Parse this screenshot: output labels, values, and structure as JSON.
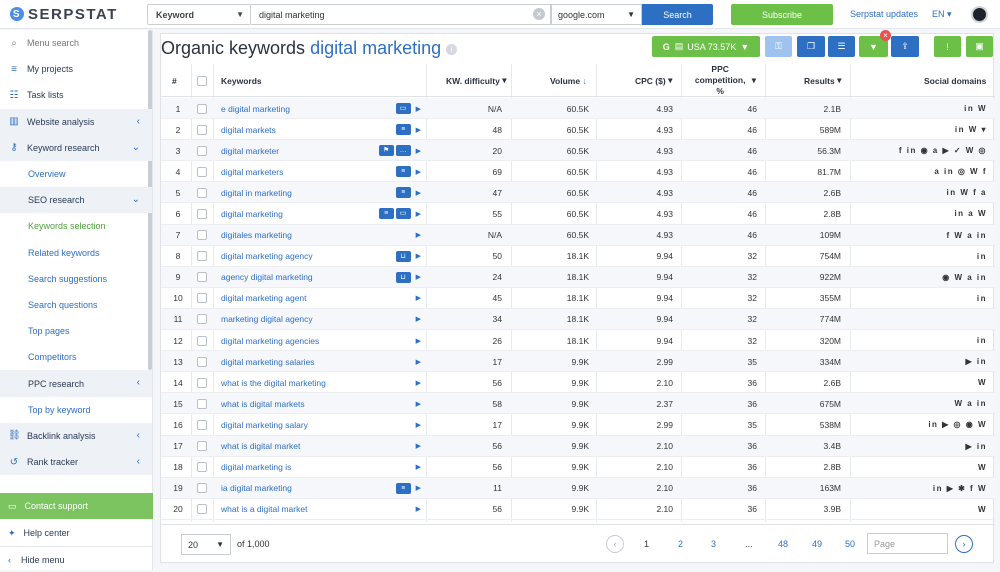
{
  "topbar": {
    "logo_text": "SERPSTAT",
    "search_type": "Keyword",
    "query": "digital marketing",
    "database": "google.com",
    "search_label": "Search",
    "subscribe_label": "Subscribe",
    "updates_label": "Serpstat updates",
    "language": "EN"
  },
  "sidebar": {
    "menu_search_placeholder": "Menu search",
    "items": [
      {
        "label": "My projects",
        "icon": "layers-icon",
        "type": "top"
      },
      {
        "label": "Task lists",
        "icon": "list-icon",
        "type": "top"
      },
      {
        "label": "Website analysis",
        "icon": "chart-icon",
        "type": "group"
      },
      {
        "label": "Keyword research",
        "icon": "key-icon",
        "type": "group"
      },
      {
        "label": "Overview",
        "type": "sub"
      },
      {
        "label": "SEO research",
        "type": "subgroup"
      },
      {
        "label": "Keywords selection",
        "type": "active"
      },
      {
        "label": "Related keywords",
        "type": "sub"
      },
      {
        "label": "Search suggestions",
        "type": "sub"
      },
      {
        "label": "Search questions",
        "type": "sub"
      },
      {
        "label": "Top pages",
        "type": "sub"
      },
      {
        "label": "Competitors",
        "type": "sub"
      },
      {
        "label": "PPC research",
        "type": "subgroup"
      },
      {
        "label": "Top by keyword",
        "type": "sub"
      },
      {
        "label": "Backlink analysis",
        "icon": "link-icon",
        "type": "group"
      },
      {
        "label": "Rank tracker",
        "icon": "refresh-icon",
        "type": "group"
      }
    ],
    "contact_label": "Contact support",
    "help_label": "Help center",
    "hide_label": "Hide menu"
  },
  "header": {
    "title_prefix": "Organic keywords",
    "title_keyword": "digital marketing",
    "country_label": "USA 73.57K"
  },
  "table": {
    "columns": [
      "#",
      "Keywords",
      "KW. difficulty",
      "Volume",
      "CPC ($)",
      "PPC competition, %",
      "Results",
      "Social domains"
    ],
    "rows": [
      {
        "n": "1",
        "kw": "e digital marketing",
        "badges": [
          "ad"
        ],
        "diff": "N/A",
        "vol": "60.5K",
        "cpc": "4.93",
        "ppc": "46",
        "res": "2.1B",
        "social": "in W"
      },
      {
        "n": "2",
        "kw": "digital markets",
        "badges": [
          "list"
        ],
        "diff": "48",
        "vol": "60.5K",
        "cpc": "4.93",
        "ppc": "46",
        "res": "589M",
        "social": "in W ▾"
      },
      {
        "n": "3",
        "kw": "digital marketer",
        "badges": [
          "flag",
          "chat"
        ],
        "diff": "20",
        "vol": "60.5K",
        "cpc": "4.93",
        "ppc": "46",
        "res": "56.3M",
        "social": "f in ◉ a ▶ ✓ W ◎"
      },
      {
        "n": "4",
        "kw": "digital marketers",
        "badges": [
          "list"
        ],
        "diff": "69",
        "vol": "60.5K",
        "cpc": "4.93",
        "ppc": "46",
        "res": "81.7M",
        "social": "a in ◎ W f"
      },
      {
        "n": "5",
        "kw": "digital in marketing",
        "badges": [
          "list"
        ],
        "diff": "47",
        "vol": "60.5K",
        "cpc": "4.93",
        "ppc": "46",
        "res": "2.6B",
        "social": "in W f a"
      },
      {
        "n": "6",
        "kw": "digital marketing",
        "badges": [
          "list",
          "ad"
        ],
        "diff": "55",
        "vol": "60.5K",
        "cpc": "4.93",
        "ppc": "46",
        "res": "2.8B",
        "social": "in a W"
      },
      {
        "n": "7",
        "kw": "digitales marketing",
        "badges": [],
        "diff": "N/A",
        "vol": "60.5K",
        "cpc": "4.93",
        "ppc": "46",
        "res": "109M",
        "social": "f W a in"
      },
      {
        "n": "8",
        "kw": "digital marketing agency",
        "badges": [
          "cart"
        ],
        "diff": "50",
        "vol": "18.1K",
        "cpc": "9.94",
        "ppc": "32",
        "res": "754M",
        "social": "in"
      },
      {
        "n": "9",
        "kw": "agency digital marketing",
        "badges": [
          "cart"
        ],
        "diff": "24",
        "vol": "18.1K",
        "cpc": "9.94",
        "ppc": "32",
        "res": "922M",
        "social": "◉ W a in"
      },
      {
        "n": "10",
        "kw": "digital marketing agent",
        "badges": [],
        "diff": "45",
        "vol": "18.1K",
        "cpc": "9.94",
        "ppc": "32",
        "res": "355M",
        "social": "in"
      },
      {
        "n": "11",
        "kw": "marketing digital agency",
        "badges": [],
        "diff": "34",
        "vol": "18.1K",
        "cpc": "9.94",
        "ppc": "32",
        "res": "774M",
        "social": ""
      },
      {
        "n": "12",
        "kw": "digital marketing agencies",
        "badges": [],
        "diff": "26",
        "vol": "18.1K",
        "cpc": "9.94",
        "ppc": "32",
        "res": "320M",
        "social": "in"
      },
      {
        "n": "13",
        "kw": "digital marketing salaries",
        "badges": [],
        "diff": "17",
        "vol": "9.9K",
        "cpc": "2.99",
        "ppc": "35",
        "res": "334M",
        "social": "▶ in"
      },
      {
        "n": "14",
        "kw": "what is the digital marketing",
        "badges": [],
        "diff": "56",
        "vol": "9.9K",
        "cpc": "2.10",
        "ppc": "36",
        "res": "2.6B",
        "social": "W"
      },
      {
        "n": "15",
        "kw": "what is digital markets",
        "badges": [],
        "diff": "58",
        "vol": "9.9K",
        "cpc": "2.37",
        "ppc": "36",
        "res": "675M",
        "social": "W a in"
      },
      {
        "n": "16",
        "kw": "digital marketing salary",
        "badges": [],
        "diff": "17",
        "vol": "9.9K",
        "cpc": "2.99",
        "ppc": "35",
        "res": "538M",
        "social": "in ▶ ◎ ◉ W"
      },
      {
        "n": "17",
        "kw": "what is digital market",
        "badges": [],
        "diff": "56",
        "vol": "9.9K",
        "cpc": "2.10",
        "ppc": "36",
        "res": "3.4B",
        "social": "▶ in"
      },
      {
        "n": "18",
        "kw": "digital marketing is",
        "badges": [],
        "diff": "56",
        "vol": "9.9K",
        "cpc": "2.10",
        "ppc": "36",
        "res": "2.8B",
        "social": "W"
      },
      {
        "n": "19",
        "kw": "ia digital marketing",
        "badges": [
          "list"
        ],
        "diff": "11",
        "vol": "9.9K",
        "cpc": "2.10",
        "ppc": "36",
        "res": "163M",
        "social": "in ▶ ✱ f W"
      },
      {
        "n": "20",
        "kw": "what is a digital market",
        "badges": [],
        "diff": "56",
        "vol": "9.9K",
        "cpc": "2.10",
        "ppc": "36",
        "res": "3.9B",
        "social": "W"
      }
    ]
  },
  "pagination": {
    "page_size": "20",
    "of_label": "of 1,000",
    "pages": [
      "1",
      "2",
      "3",
      "...",
      "48",
      "49",
      "50"
    ],
    "current": "1",
    "page_placeholder": "Page"
  },
  "colors": {
    "brand_blue": "#2d6fc3",
    "green": "#6cbf47"
  }
}
